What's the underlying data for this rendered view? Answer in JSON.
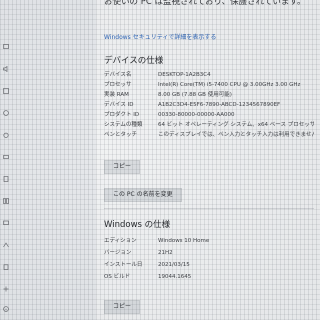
{
  "intro_text": "お使いの PC は監視されており、保護されています。",
  "security_link": "Windows セキュリティで詳細を表示する",
  "device_specs": {
    "heading": "デバイスの仕様",
    "rows": [
      {
        "label": "デバイス名",
        "value": "DESKTOP-1A2B3C4"
      },
      {
        "label": "プロセッサ",
        "value": "Intel(R) Core(TM) i5-7400 CPU @ 3.00GHz   3.00 GHz"
      },
      {
        "label": "実装 RAM",
        "value": "8.00 GB (7.88 GB 使用可能)"
      },
      {
        "label": "デバイス ID",
        "value": "A1B2C3D4-E5F6-7890-ABCD-1234567890EF"
      },
      {
        "label": "プロダクト ID",
        "value": "00330-80000-00000-AA000"
      },
      {
        "label": "システムの種類",
        "value": "64 ビット オペレーティング システム、x64 ベース プロセッサ"
      },
      {
        "label": "ペンとタッチ",
        "value": "このディスプレイでは、ペン入力とタッチ入力は利用できません"
      }
    ],
    "copy_button": "コピー"
  },
  "rename_button": "この PC の名前を変更",
  "windows_specs": {
    "heading": "Windows の仕様",
    "rows": [
      {
        "label": "エディション",
        "value": "Windows 10 Home"
      },
      {
        "label": "バージョン",
        "value": "21H2"
      },
      {
        "label": "インストール日",
        "value": "2021/03/15"
      },
      {
        "label": "OS ビルド",
        "value": "19044.1645"
      }
    ],
    "copy_button": "コピー"
  },
  "sidebar": {
    "items": [
      {
        "label": "",
        "icon": "display-icon"
      },
      {
        "label": "",
        "icon": "sound-icon"
      },
      {
        "label": "",
        "icon": "notifications-icon"
      },
      {
        "label": "",
        "icon": "focus-icon"
      },
      {
        "label": "",
        "icon": "power-icon"
      },
      {
        "label": "",
        "icon": "storage-icon"
      },
      {
        "label": "",
        "icon": "tablet-icon"
      },
      {
        "label": "",
        "icon": "multitasking-icon"
      },
      {
        "label": "",
        "icon": "projecting-icon"
      },
      {
        "label": "",
        "icon": "shared-icon"
      },
      {
        "label": "",
        "icon": "clipboard-icon"
      },
      {
        "label": "",
        "icon": "remote-icon"
      },
      {
        "label": "",
        "icon": "about-icon"
      }
    ]
  },
  "colors": {
    "link": "#2a63b8",
    "background": "#f1f2f3",
    "sidebar": "#e6e8eb"
  }
}
